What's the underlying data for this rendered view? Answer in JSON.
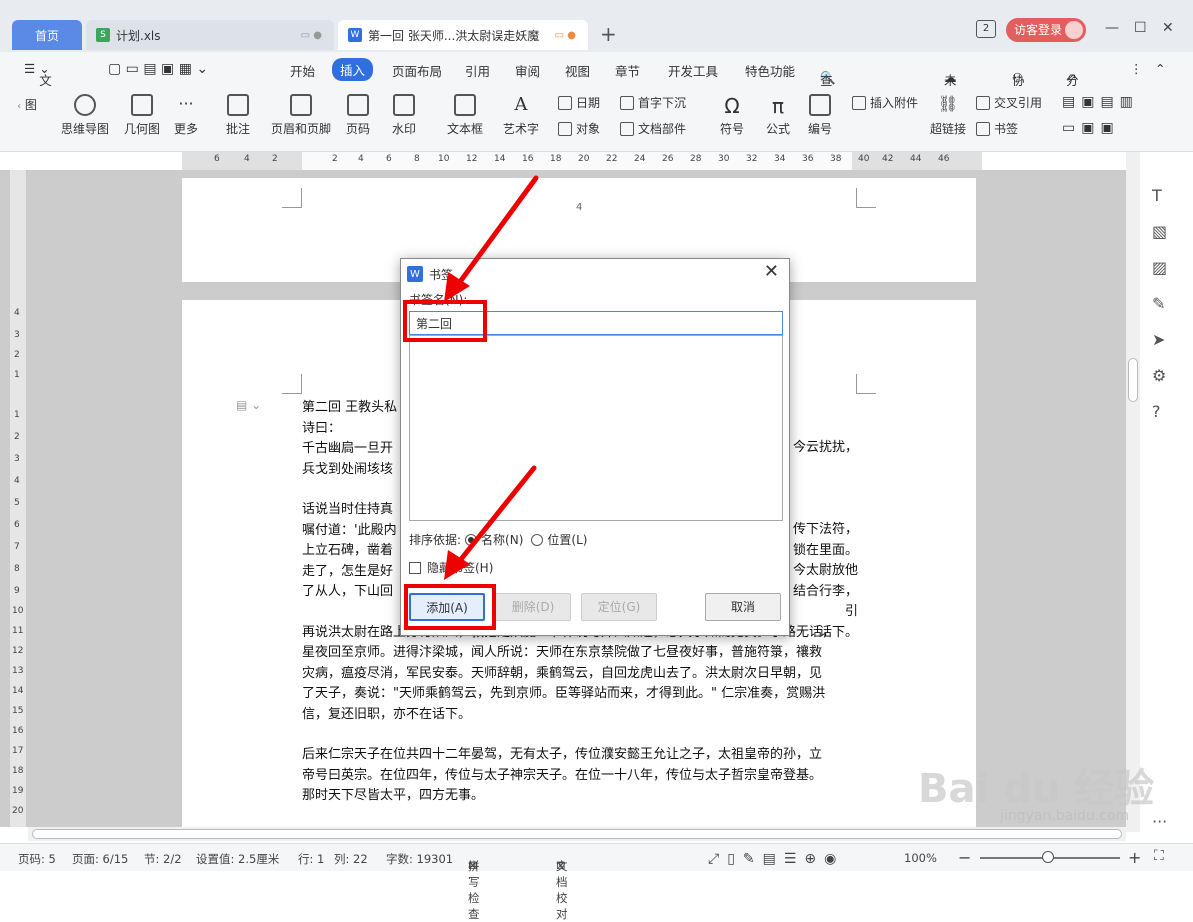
{
  "tabs": {
    "home": "首页",
    "xls": "计划.xls",
    "doc": "第一回 张天师...洪太尉误走妖魔"
  },
  "titlebar": {
    "badge": "2",
    "login": "访客登录"
  },
  "menu": {
    "file": "文件",
    "items": [
      "开始",
      "插入",
      "页面布局",
      "引用",
      "审阅",
      "视图",
      "章节",
      "开发工具",
      "特色功能"
    ],
    "search": "查找",
    "right": [
      "未同步",
      "协作",
      "分享"
    ]
  },
  "ribbon": {
    "big": [
      "思维导图",
      "几何图",
      "更多",
      "批注",
      "页眉和页脚",
      "页码",
      "水印",
      "文本框",
      "艺术字",
      "符号",
      "公式",
      "编号",
      "超链接"
    ],
    "small": [
      "日期",
      "首字下沉",
      "对象",
      "文档部件",
      "插入附件",
      "交叉引用",
      "书签"
    ],
    "cut": "图"
  },
  "ruler": [
    "6",
    "4",
    "2",
    "2",
    "4",
    "6",
    "8",
    "10",
    "12",
    "14",
    "16",
    "18",
    "20",
    "22",
    "24",
    "26",
    "28",
    "30",
    "32",
    "34",
    "36",
    "38",
    "40",
    "42",
    "44",
    "46"
  ],
  "vruler": [
    "4",
    "3",
    "2",
    "1",
    "1",
    "2",
    "3",
    "4",
    "5",
    "6",
    "7",
    "8",
    "9",
    "10",
    "11",
    "12",
    "13",
    "14",
    "15",
    "16",
    "17",
    "18",
    "19",
    "20"
  ],
  "document": {
    "page_number": "4",
    "lines": [
      "第二回 王教头私",
      "诗曰：",
      "千古幽扃一旦开",
      "兵戈到处闹垓垓",
      "",
      "话说当时住持真",
      "嘱付道：'此殿内",
      "上立石碑，凿着",
      "走了，怎生是好",
      "了从人，下山回",
      "",
      "再说洪太尉在路上分付从人，教把走妖魔一节休说与外人知道，恐天子知而见责。于路无话，",
      "星夜回至京师。进得汴梁城，闻人所说：天师在东京禁院做了七昼夜好事，普施符箓，禳救",
      "灾病，瘟疫尽消，军民安泰。天师辞朝，乘鹤驾云，自回龙虎山去了。洪太尉次日早朝，见",
      "了天子，奏说：\"天师乘鹤驾云，先到京师。臣等驿站而来，才得到此。\" 仁宗准奏，赏赐洪",
      "信，复还旧职，亦不在话下。",
      "",
      "后来仁宗天子在位共四十二年晏驾，无有太子，传位濮安懿王允让之子，太祖皇帝的孙，立",
      "帝号曰英宗。在位四年，传位与太子神宗天子。在位一十八年，传位与太子哲宗皇帝登基。",
      "那时天下尽皆太平，四方无事。"
    ],
    "right_fragments": [
      "今云扰扰，",
      "传下法符，",
      "锁在里面。",
      "今太尉放他",
      "结合行李，引",
      "话下。"
    ]
  },
  "dialog": {
    "title": "书签",
    "label": "书签名(N):",
    "input_value": "第二回",
    "sort_label": "排序依据:",
    "sort_name": "名称(N)",
    "sort_position": "位置(L)",
    "hidden": "隐藏书签(H)",
    "add": "添加(A)",
    "delete": "删除(D)",
    "locate": "定位(G)",
    "cancel": "取消"
  },
  "statusbar": {
    "pagecode": "页码: 5",
    "page": "页面: 6/15",
    "section": "节: 2/2",
    "setting": "设置值: 2.5厘米",
    "row": "行: 1",
    "col": "列: 22",
    "words": "字数: 19301",
    "spell": "拼写检查",
    "proof": "文档校对",
    "zoom": "100%"
  },
  "watermark": {
    "text": "Bai du 经验",
    "url": "jingyan.baidu.com"
  }
}
